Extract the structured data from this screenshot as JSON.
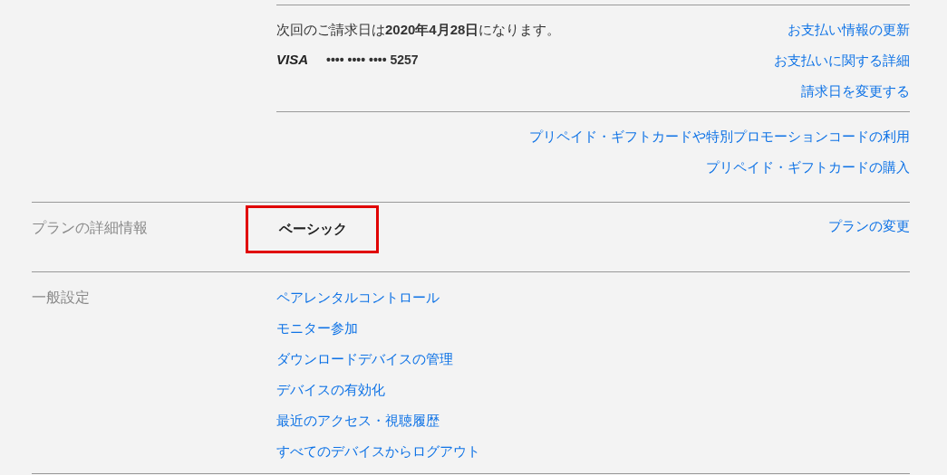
{
  "billing": {
    "next_billing": "次回のご請求日は**2020年4月28日**になります。",
    "card_brand": "VISA",
    "card_number": "•••• •••• •••• 5257",
    "links": [
      "お支払い情報の更新",
      "お支払いに関する詳細",
      "請求日を変更する"
    ]
  },
  "gift_links": [
    "プリペイド・ギフトカードや特別プロモーションコードの利用",
    "プリペイド・ギフトカードの購入"
  ],
  "plan": {
    "label": "プランの詳細情報",
    "name": "ベーシック",
    "highlighted": true,
    "link": "プランの変更"
  },
  "settings": {
    "label": "一般設定",
    "links": [
      "ペアレンタルコントロール",
      "モニター参加",
      "ダウンロードデバイスの管理",
      "デバイスの有効化",
      "最近のアクセス・視聴履歴",
      "すべてのデバイスからログアウト"
    ]
  }
}
